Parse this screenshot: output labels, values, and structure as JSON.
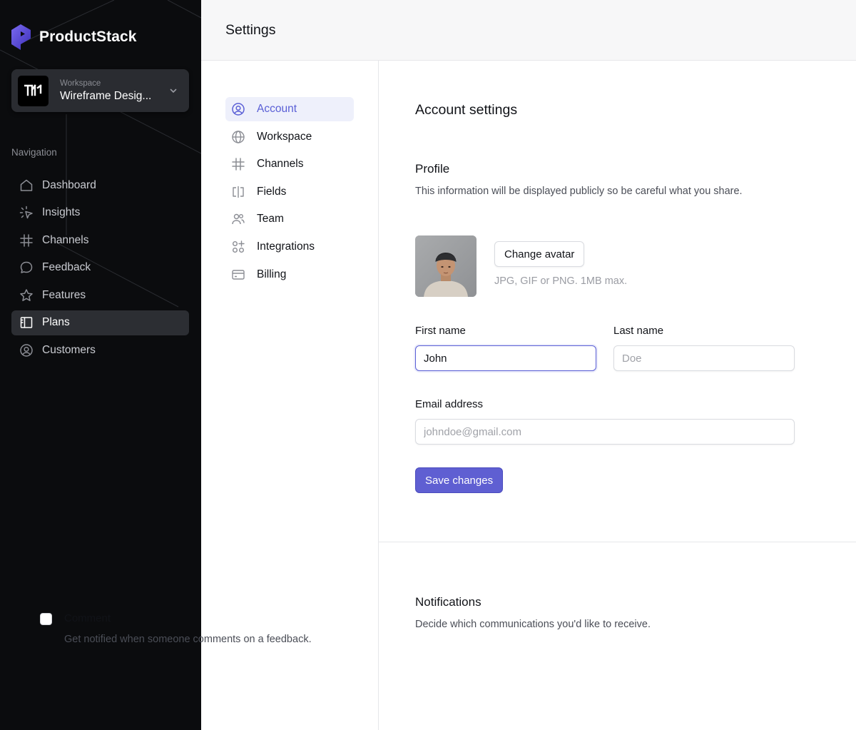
{
  "app": {
    "brand_name": "ProductStack",
    "workspace": {
      "label": "Workspace",
      "name": "Wireframe Desig...",
      "logo_text": "W"
    }
  },
  "sidebar": {
    "nav_heading": "Navigation",
    "items": [
      {
        "label": "Dashboard",
        "icon": "home-icon",
        "active": false
      },
      {
        "label": "Insights",
        "icon": "sparkle-icon",
        "active": false
      },
      {
        "label": "Channels",
        "icon": "hash-icon",
        "active": false
      },
      {
        "label": "Feedback",
        "icon": "chat-bubble-icon",
        "active": false
      },
      {
        "label": "Features",
        "icon": "star-icon",
        "active": false
      },
      {
        "label": "Plans",
        "icon": "book-icon",
        "active": true
      },
      {
        "label": "Customers",
        "icon": "user-circle-icon",
        "active": false
      }
    ]
  },
  "header": {
    "title": "Settings"
  },
  "settings_nav": {
    "items": [
      {
        "label": "Account",
        "icon": "user-circle-icon",
        "active": true
      },
      {
        "label": "Workspace",
        "icon": "globe-icon",
        "active": false
      },
      {
        "label": "Channels",
        "icon": "hash-icon",
        "active": false
      },
      {
        "label": "Fields",
        "icon": "text-cursor-icon",
        "active": false
      },
      {
        "label": "Team",
        "icon": "users-icon",
        "active": false
      },
      {
        "label": "Integrations",
        "icon": "apps-icon",
        "active": false
      },
      {
        "label": "Billing",
        "icon": "credit-card-icon",
        "active": false
      }
    ]
  },
  "main": {
    "heading": "Account settings",
    "profile": {
      "title": "Profile",
      "description": "This information will be displayed publicly so be careful what you share.",
      "change_avatar_label": "Change avatar",
      "avatar_hint": "JPG, GIF or PNG. 1MB max.",
      "first_name": {
        "label": "First name",
        "value": "John",
        "placeholder": ""
      },
      "last_name": {
        "label": "Last name",
        "value": "",
        "placeholder": "Doe"
      },
      "email": {
        "label": "Email address",
        "value": "",
        "placeholder": "johndoe@gmail.com"
      },
      "save_label": "Save changes"
    },
    "notifications": {
      "title": "Notifications",
      "description": "Decide which communications you'd like to receive.",
      "options": [
        {
          "label": "Comment",
          "description": "Get notified when someone comments on a feedback.",
          "checked": false
        }
      ]
    }
  },
  "colors": {
    "accent": "#5f5fd2",
    "accent_text": "#5a5fd6",
    "sidebar_bg": "#0b0c0e",
    "sidebar_active_bg": "#2c2e33",
    "brand_gradient_start": "#6d5ce7",
    "brand_gradient_end": "#3b2fb8"
  }
}
